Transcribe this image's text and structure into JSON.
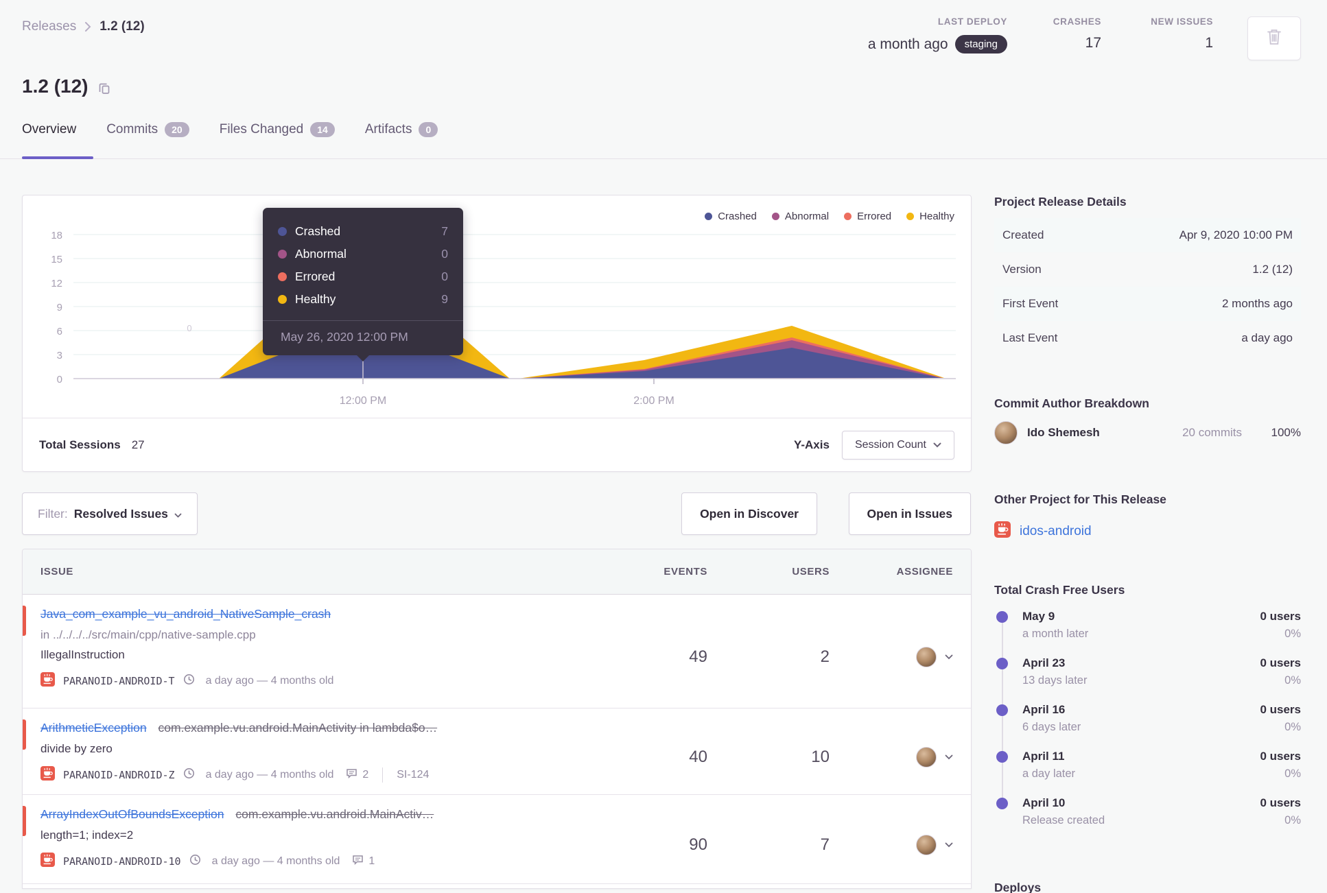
{
  "breadcrumb": {
    "root": "Releases",
    "current": "1.2 (12)"
  },
  "header_stats": {
    "last_deploy": {
      "label": "LAST DEPLOY",
      "value": "a month ago",
      "badge": "staging"
    },
    "crashes": {
      "label": "CRASHES",
      "value": "17"
    },
    "new_issues": {
      "label": "NEW ISSUES",
      "value": "1"
    }
  },
  "page_title": "1.2 (12)",
  "tabs": [
    {
      "label": "Overview",
      "active": true
    },
    {
      "label": "Commits",
      "count": "20"
    },
    {
      "label": "Files Changed",
      "count": "14"
    },
    {
      "label": "Artifacts",
      "count": "0"
    }
  ],
  "colors": {
    "accent": "#6c5fc7",
    "link": "#3d74db",
    "error_level": "#e8594a",
    "staging_badge_bg": "#3c3547",
    "tooltip_bg": "#36313f"
  },
  "chart_data": {
    "type": "area",
    "stacked": true,
    "title": "Sessions by status over time",
    "ylabel": "Session Count",
    "ylim": [
      0,
      18
    ],
    "grid": true,
    "legend_position": "top-right",
    "y_ticks": [
      0,
      3,
      6,
      9,
      12,
      15,
      18
    ],
    "x_ticks": [
      "12:00 PM",
      "2:00 PM"
    ],
    "point_label": "0",
    "series": [
      {
        "name": "Crashed",
        "color": "#4e5596",
        "points_estimate": [
          [
            "11:00 AM",
            0
          ],
          [
            "12:00 PM",
            7
          ],
          [
            "1:00 PM",
            0
          ],
          [
            "1:50 PM",
            1
          ],
          [
            "2:50 PM",
            4
          ],
          [
            "3:50 PM",
            0
          ]
        ]
      },
      {
        "name": "Abnormal",
        "color": "#a35488",
        "points_estimate": [
          [
            "11:00 AM",
            0
          ],
          [
            "12:00 PM",
            0
          ],
          [
            "1:00 PM",
            0
          ],
          [
            "1:50 PM",
            0
          ],
          [
            "2:50 PM",
            1
          ],
          [
            "3:50 PM",
            0
          ]
        ]
      },
      {
        "name": "Errored",
        "color": "#ed6e5f",
        "points_estimate": [
          [
            "11:00 AM",
            0
          ],
          [
            "12:00 PM",
            0
          ],
          [
            "1:00 PM",
            0
          ],
          [
            "1:50 PM",
            0
          ],
          [
            "2:50 PM",
            0
          ],
          [
            "3:50 PM",
            0
          ]
        ]
      },
      {
        "name": "Healthy",
        "color": "#f2b712",
        "points_estimate": [
          [
            "11:00 AM",
            0
          ],
          [
            "12:00 PM",
            9
          ],
          [
            "1:00 PM",
            0
          ],
          [
            "1:50 PM",
            1
          ],
          [
            "2:50 PM",
            2
          ],
          [
            "3:50 PM",
            0
          ]
        ]
      }
    ],
    "hover_tooltip": {
      "date": "May 26, 2020 12:00 PM",
      "rows": [
        {
          "label": "Crashed",
          "value": "7"
        },
        {
          "label": "Abnormal",
          "value": "0"
        },
        {
          "label": "Errored",
          "value": "0"
        },
        {
          "label": "Healthy",
          "value": "9"
        }
      ]
    }
  },
  "chart_footer": {
    "total_sessions_label": "Total Sessions",
    "total_sessions_value": "27",
    "y_axis_label": "Y-Axis",
    "y_axis_value": "Session Count"
  },
  "filter_bar": {
    "filter_label": "Filter:",
    "filter_value": "Resolved Issues",
    "discover_button": "Open in Discover",
    "issues_button": "Open in Issues"
  },
  "issues": {
    "columns": {
      "issue": "ISSUE",
      "events": "EVENTS",
      "users": "USERS",
      "assignee": "ASSIGNEE"
    },
    "rows": [
      {
        "title": "Java_com_example_vu_android_NativeSample_crash",
        "subtitle": "",
        "location": "in ../../../../src/main/cpp/native-sample.cpp",
        "culprit": "IllegalInstruction",
        "project": "PARANOID-ANDROID-T",
        "age": "a day ago — 4 months old",
        "events": "49",
        "users": "2"
      },
      {
        "title": "ArithmeticException",
        "subtitle": "com.example.vu.android.MainActivity in lambda$o…",
        "culprit": "divide by zero",
        "project": "PARANOID-ANDROID-Z",
        "age": "a day ago — 4 months old",
        "comments": "2",
        "ticket": "SI-124",
        "events": "40",
        "users": "10"
      },
      {
        "title": "ArrayIndexOutOfBoundsException",
        "subtitle": "com.example.vu.android.MainActiv…",
        "culprit": "length=1; index=2",
        "project": "PARANOID-ANDROID-10",
        "age": "a day ago — 4 months old",
        "comments": "1",
        "events": "90",
        "users": "7"
      }
    ]
  },
  "sidebar": {
    "release_details": {
      "title": "Project Release Details",
      "rows": [
        {
          "label": "Created",
          "value": "Apr 9, 2020 10:00 PM"
        },
        {
          "label": "Version",
          "value": "1.2 (12)"
        },
        {
          "label": "First Event",
          "value": "2 months ago"
        },
        {
          "label": "Last Event",
          "value": "a day ago"
        }
      ]
    },
    "commit_authors": {
      "title": "Commit Author Breakdown",
      "author": {
        "name": "Ido Shemesh",
        "commits": "20 commits",
        "percent": "100%"
      }
    },
    "other_project": {
      "title": "Other Project for This Release",
      "project": "idos-android"
    },
    "crash_free": {
      "title": "Total Crash Free Users",
      "entries": [
        {
          "date": "May 9",
          "offset": "a month later",
          "users": "0 users",
          "percent": "0%"
        },
        {
          "date": "April 23",
          "offset": "13 days later",
          "users": "0 users",
          "percent": "0%"
        },
        {
          "date": "April 16",
          "offset": "6 days later",
          "users": "0 users",
          "percent": "0%"
        },
        {
          "date": "April 11",
          "offset": "a day later",
          "users": "0 users",
          "percent": "0%"
        },
        {
          "date": "April 10",
          "offset": "Release created",
          "users": "0 users",
          "percent": "0%"
        }
      ]
    },
    "deploys_title": "Deploys"
  }
}
